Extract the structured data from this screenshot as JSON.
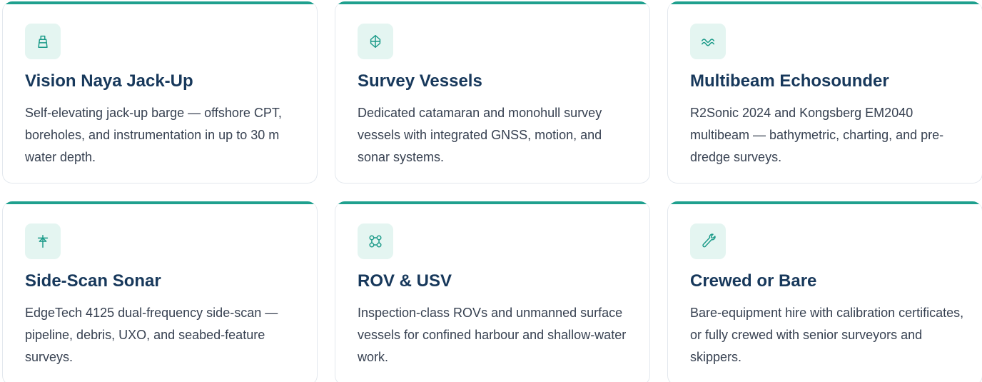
{
  "cards": [
    {
      "icon": "jackup-barge-icon",
      "title": "Vision Naya Jack-Up",
      "description": "Self-elevating jack-up barge — offshore CPT, boreholes, and instrumentation in up to 30 m water depth."
    },
    {
      "icon": "vessel-icon",
      "title": "Survey Vessels",
      "description": "Dedicated catamaran and monohull survey vessels with integrated GNSS, motion, and sonar systems."
    },
    {
      "icon": "waves-icon",
      "title": "Multibeam Echosounder",
      "description": "R2Sonic 2024 and Kongsberg EM2040 multibeam — bathymetric, charting, and pre-dredge surveys."
    },
    {
      "icon": "sonar-array-icon",
      "title": "Side-Scan Sonar",
      "description": "EdgeTech 4125 dual-frequency side-scan — pipeline, debris, UXO, and seabed-feature surveys."
    },
    {
      "icon": "rov-icon",
      "title": "ROV & USV",
      "description": "Inspection-class ROVs and unmanned surface vessels for confined harbour and shallow-water work."
    },
    {
      "icon": "wrench-icon",
      "title": "Crewed or Bare",
      "description": "Bare-equipment hire with calibration certificates, or fully crewed with senior surveyors and skippers."
    }
  ],
  "colors": {
    "accent": "#1fa08e",
    "icon_bg": "#e4f5f1",
    "title": "#17385b",
    "text": "#374151"
  }
}
